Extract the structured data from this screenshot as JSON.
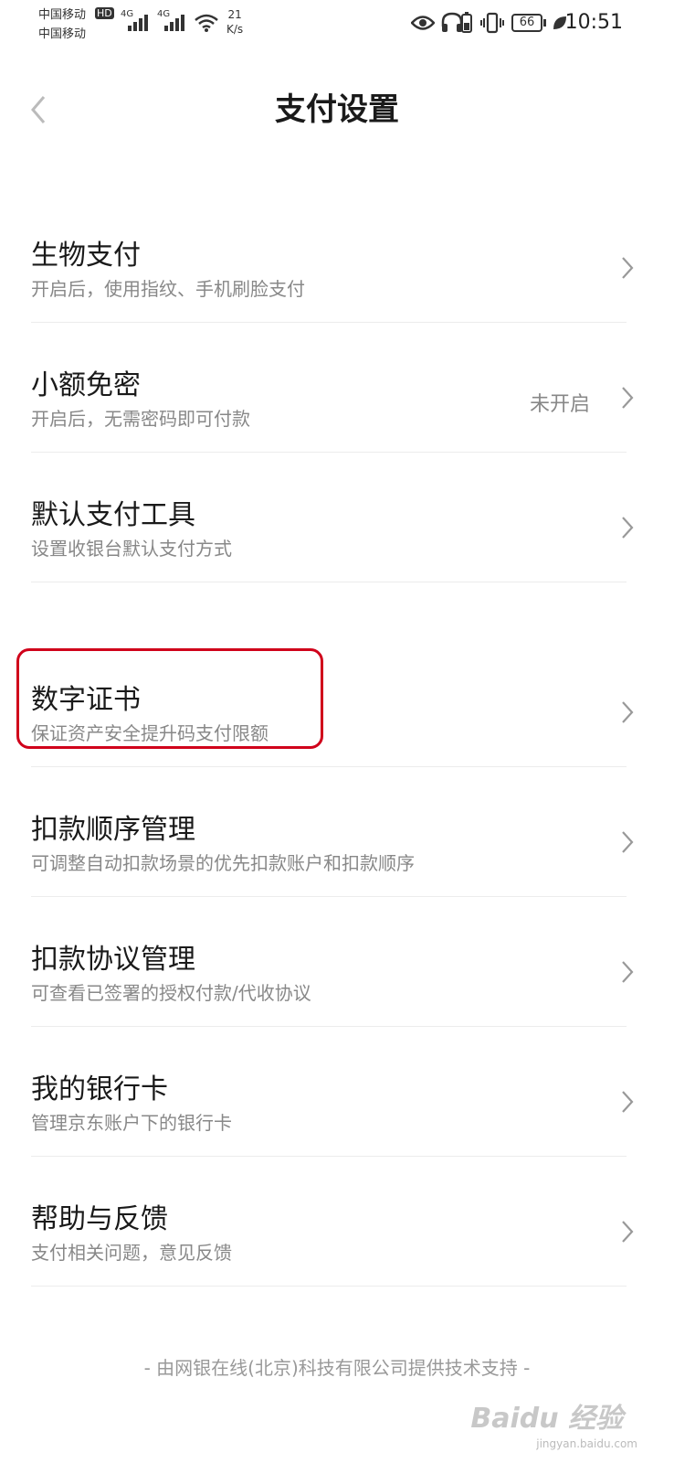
{
  "status_bar": {
    "carrier1": "中国移动",
    "carrier2": "中国移动",
    "hd": "HD",
    "net1": "4G",
    "net2": "4G",
    "speed_value": "21",
    "speed_unit": "K/s",
    "battery": "66",
    "time": "10:51"
  },
  "header": {
    "title": "支付设置",
    "back_icon": "chevron-left-icon"
  },
  "items": [
    {
      "title": "生物支付",
      "desc": "开启后，使用指纹、手机刷脸支付",
      "status": ""
    },
    {
      "title": "小额免密",
      "desc": "开启后，无需密码即可付款",
      "status": "未开启"
    },
    {
      "title": "默认支付工具",
      "desc": "设置收银台默认支付方式",
      "status": ""
    },
    {
      "title": "数字证书",
      "desc": "保证资产安全提升码支付限额",
      "status": ""
    },
    {
      "title": "扣款顺序管理",
      "desc": "可调整自动扣款场景的优先扣款账户和扣款顺序",
      "status": ""
    },
    {
      "title": "扣款协议管理",
      "desc": "可查看已签署的授权付款/代收协议",
      "status": ""
    },
    {
      "title": "我的银行卡",
      "desc": "管理京东账户下的银行卡",
      "status": ""
    },
    {
      "title": "帮助与反馈",
      "desc": "支付相关问题，意见反馈",
      "status": ""
    }
  ],
  "footer": "- 由网银在线(北京)科技有限公司提供技术支持 -",
  "watermark": {
    "text": "jingyan.baidu.com",
    "logo": "Baidu 经验"
  },
  "colors": {
    "highlight_border": "#d0021b",
    "title_text": "#1a1a1a",
    "desc_text": "#888888"
  }
}
